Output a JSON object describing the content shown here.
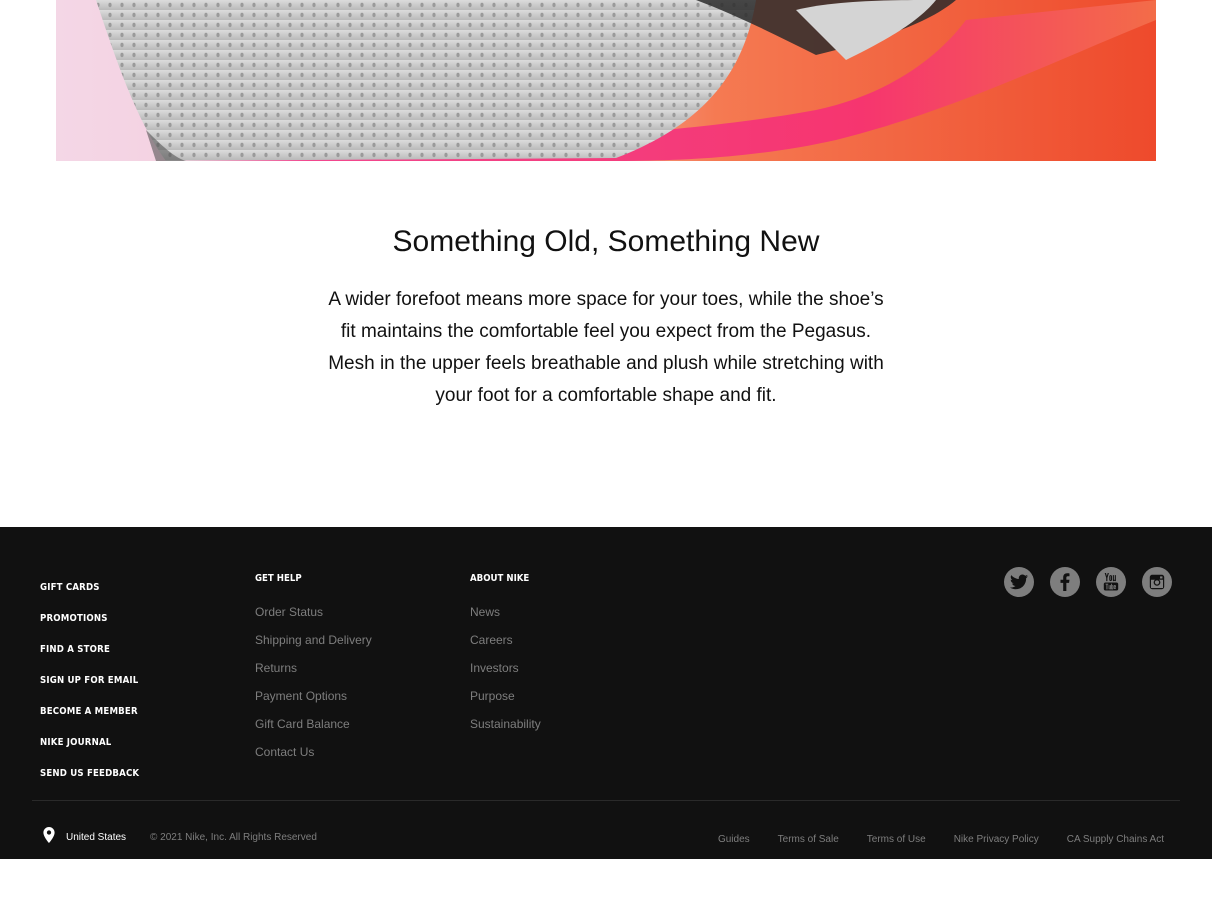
{
  "feature": {
    "title": "Something Old, Something New",
    "body": "A wider forefoot means more space for your toes, while the shoe’s fit maintains the comfortable feel you expect from the Pegasus. Mesh in the upper feels breathable and plush while stretching with your foot for a comfortable shape and fit."
  },
  "footer": {
    "primary_links": [
      "Gift Cards",
      "Promotions",
      "Find a Store",
      "Sign Up for Email",
      "Become a Member",
      "Nike Journal",
      "Send Us Feedback"
    ],
    "get_help": {
      "heading": "Get Help",
      "links": [
        "Order Status",
        "Shipping and Delivery",
        "Returns",
        "Payment Options",
        "Gift Card Balance",
        "Contact Us"
      ]
    },
    "about": {
      "heading": "About Nike",
      "links": [
        "News",
        "Careers",
        "Investors",
        "Purpose",
        "Sustainability"
      ]
    },
    "social_icons": [
      "twitter-icon",
      "facebook-icon",
      "youtube-icon",
      "instagram-icon"
    ],
    "locale": "United States",
    "copyright": "© 2021 Nike, Inc. All Rights Reserved",
    "legal_links": [
      "Guides",
      "Terms of Sale",
      "Terms of Use",
      "Nike Privacy Policy",
      "CA Supply Chains Act"
    ]
  },
  "colors": {
    "footer_bg": "#111111",
    "muted_text": "#7e7e7e",
    "hero_orange": "#f0532e",
    "hero_pink": "#f0407a"
  }
}
